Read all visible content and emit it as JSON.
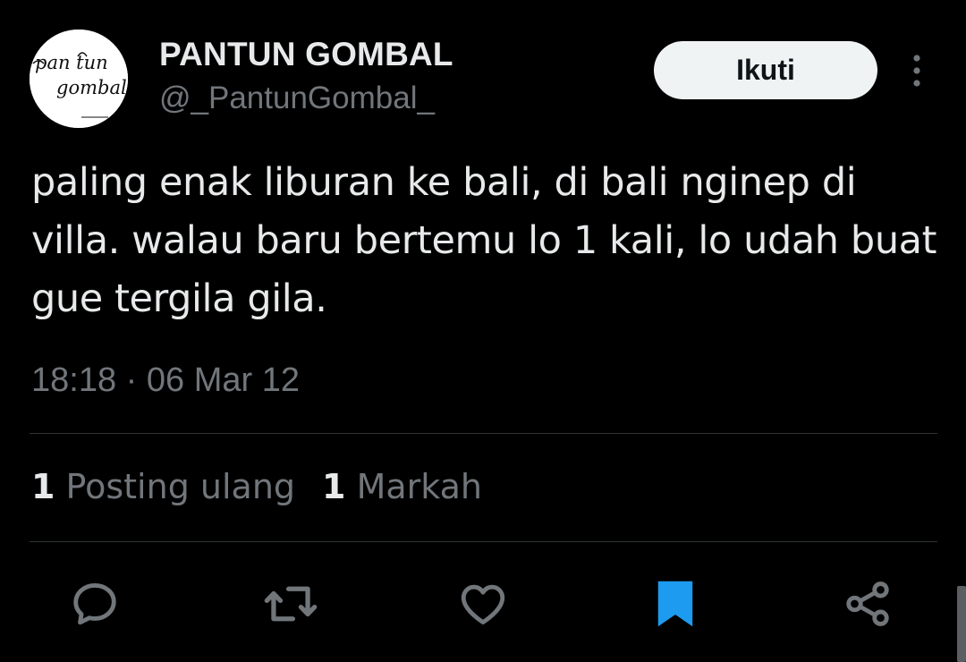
{
  "author": {
    "display_name": "PANTUN GOMBAL",
    "handle": "@_PantunGombal_",
    "avatar_text": [
      "pan tun",
      "gombal"
    ]
  },
  "follow_label": "Ikuti",
  "tweet_text": "paling enak liburan ke bali, di bali nginep di villa. walau baru bertemu lo 1 kali, lo udah buat gue tergila gila.",
  "timestamp": "18:18 · 06 Mar 12",
  "stats": {
    "reposts_count": "1",
    "reposts_label": "Posting ulang",
    "bookmarks_count": "1",
    "bookmarks_label": "Markah"
  },
  "actions": [
    {
      "icon": "reply-icon"
    },
    {
      "icon": "retweet-icon"
    },
    {
      "icon": "like-icon"
    },
    {
      "icon": "bookmark-icon",
      "active": true,
      "color": "#1d9bf0"
    },
    {
      "icon": "share-icon"
    }
  ],
  "colors": {
    "background": "#000000",
    "text_primary": "#e7e9ea",
    "text_secondary": "#71767b",
    "accent": "#1d9bf0",
    "divider": "#2f3336"
  }
}
